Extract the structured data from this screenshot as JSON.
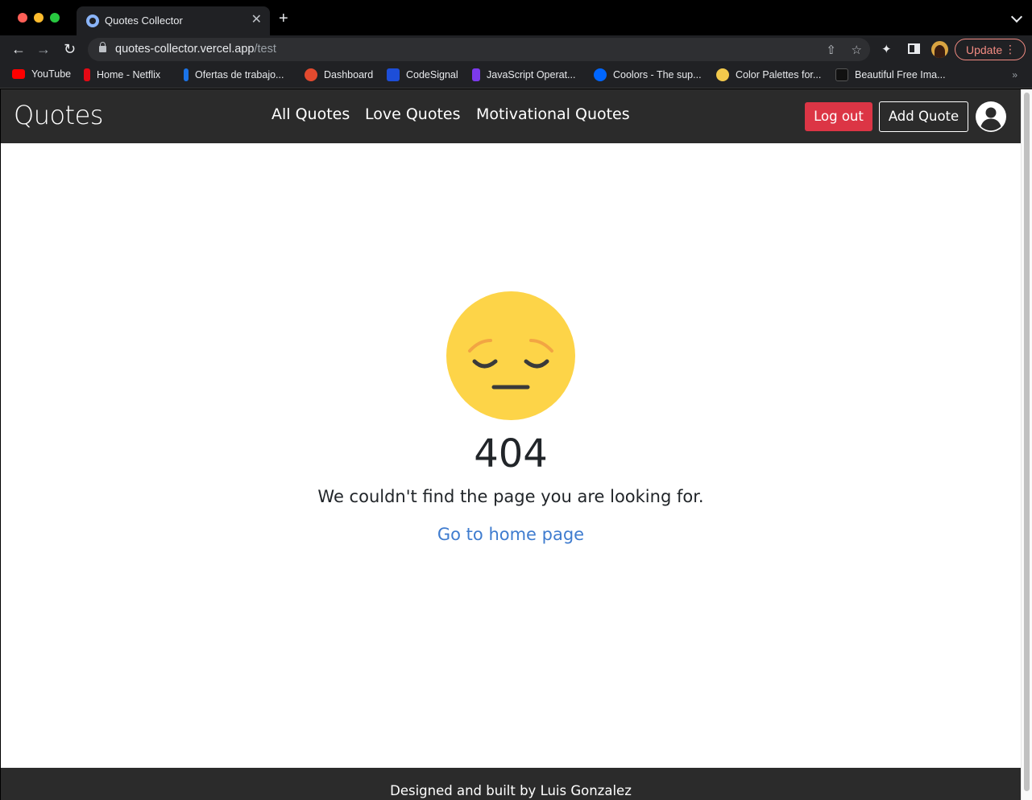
{
  "browser": {
    "tab_title": "Quotes Collector",
    "tab_close": "✕",
    "new_tab": "+",
    "url_host": "quotes-collector.vercel.app",
    "url_path": "/test",
    "update_label": "Update",
    "bookmarks": [
      {
        "label": "YouTube",
        "color": "#ff0000"
      },
      {
        "label": "Home - Netflix",
        "color": "#e50914"
      },
      {
        "label": "Ofertas de trabajo...",
        "color": "#1a73e8"
      },
      {
        "label": "Dashboard",
        "color": "#e34a2f"
      },
      {
        "label": "CodeSignal",
        "color": "#1d4ed8"
      },
      {
        "label": "JavaScript Operat...",
        "color": "#7c3aed"
      },
      {
        "label": "Coolors - The sup...",
        "color": "#0066ff"
      },
      {
        "label": "Color Palettes for...",
        "color": "#f2c94c"
      },
      {
        "label": "Beautiful Free Ima...",
        "color": "#111111"
      }
    ],
    "bookmarks_more": "»"
  },
  "site": {
    "brand": "Quotes",
    "nav": [
      {
        "label": "All Quotes"
      },
      {
        "label": "Love Quotes"
      },
      {
        "label": "Motivational Quotes"
      }
    ],
    "logout_label": "Log out",
    "add_quote_label": "Add Quote"
  },
  "not_found": {
    "code": "404",
    "message": "We couldn't find the page you are looking for.",
    "home_link": "Go to home page"
  },
  "footer": {
    "text": "Designed and built by Luis Gonzalez"
  },
  "colors": {
    "navbar_bg": "#2b2b2b",
    "danger": "#dc3545",
    "link": "#3f7ccf",
    "emoji_face": "#fdd448",
    "update_accent": "#f28b82"
  },
  "icons": {
    "emoji": "pensive-face-icon",
    "avatar": "user-circle-icon"
  }
}
